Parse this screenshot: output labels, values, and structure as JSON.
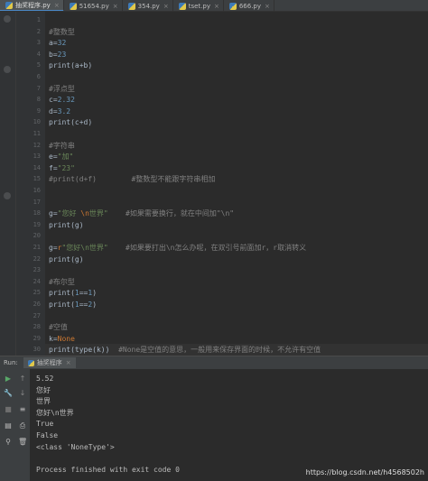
{
  "tabs": [
    {
      "label": "抽奖程序.py",
      "active": true
    },
    {
      "label": "51654.py",
      "active": false
    },
    {
      "label": "354.py",
      "active": false
    },
    {
      "label": "tset.py",
      "active": false
    },
    {
      "label": "666.py",
      "active": false
    }
  ],
  "tab_close_glyph": "×",
  "current_line": 30,
  "code_lines": [
    {
      "n": "1",
      "tokens": []
    },
    {
      "n": "2",
      "tokens": [
        {
          "t": "#整数型",
          "c": "cmt"
        }
      ]
    },
    {
      "n": "3",
      "tokens": [
        {
          "t": "a=",
          "c": "plain"
        },
        {
          "t": "32",
          "c": "num"
        }
      ]
    },
    {
      "n": "4",
      "tokens": [
        {
          "t": "b=",
          "c": "plain"
        },
        {
          "t": "23",
          "c": "num"
        }
      ]
    },
    {
      "n": "5",
      "tokens": [
        {
          "t": "print(a+b)",
          "c": "plain"
        }
      ]
    },
    {
      "n": "6",
      "tokens": []
    },
    {
      "n": "7",
      "tokens": [
        {
          "t": "#浮点型",
          "c": "cmt"
        }
      ]
    },
    {
      "n": "8",
      "tokens": [
        {
          "t": "c=",
          "c": "plain"
        },
        {
          "t": "2.32",
          "c": "num"
        }
      ]
    },
    {
      "n": "9",
      "tokens": [
        {
          "t": "d=",
          "c": "plain"
        },
        {
          "t": "3.2",
          "c": "num"
        }
      ]
    },
    {
      "n": "10",
      "tokens": [
        {
          "t": "print(c+d)",
          "c": "plain"
        }
      ]
    },
    {
      "n": "11",
      "tokens": []
    },
    {
      "n": "12",
      "tokens": [
        {
          "t": "#字符串",
          "c": "cmt"
        }
      ]
    },
    {
      "n": "13",
      "tokens": [
        {
          "t": "e=",
          "c": "plain"
        },
        {
          "t": "\"加\"",
          "c": "str"
        }
      ]
    },
    {
      "n": "14",
      "tokens": [
        {
          "t": "f=",
          "c": "plain"
        },
        {
          "t": "\"23\"",
          "c": "str"
        }
      ]
    },
    {
      "n": "15",
      "tokens": [
        {
          "t": "#print(d+f)        #整数型不能跟字符串相加",
          "c": "cmt"
        }
      ]
    },
    {
      "n": "16",
      "tokens": []
    },
    {
      "n": "17",
      "tokens": []
    },
    {
      "n": "18",
      "tokens": [
        {
          "t": "g=",
          "c": "plain"
        },
        {
          "t": "\"您好 ",
          "c": "str"
        },
        {
          "t": "\\n",
          "c": "kw"
        },
        {
          "t": "世界\"",
          "c": "str"
        },
        {
          "t": "    #如果需要换行，就在中间加\"\\n\"",
          "c": "cmt"
        }
      ]
    },
    {
      "n": "19",
      "tokens": [
        {
          "t": "print(g)",
          "c": "plain"
        }
      ]
    },
    {
      "n": "20",
      "tokens": []
    },
    {
      "n": "21",
      "tokens": [
        {
          "t": "g=",
          "c": "plain"
        },
        {
          "t": "r",
          "c": "kw"
        },
        {
          "t": "\"您好\\n世界\"",
          "c": "str"
        },
        {
          "t": "    #如果要打出\\n怎么办呢，在双引号前面加r，r取消转义",
          "c": "cmt"
        }
      ]
    },
    {
      "n": "22",
      "tokens": [
        {
          "t": "print(g)",
          "c": "plain"
        }
      ]
    },
    {
      "n": "23",
      "tokens": []
    },
    {
      "n": "24",
      "tokens": [
        {
          "t": "#布尔型",
          "c": "cmt"
        }
      ]
    },
    {
      "n": "25",
      "tokens": [
        {
          "t": "print(",
          "c": "plain"
        },
        {
          "t": "1",
          "c": "num"
        },
        {
          "t": "==",
          "c": "plain"
        },
        {
          "t": "1",
          "c": "num"
        },
        {
          "t": ")",
          "c": "plain"
        }
      ]
    },
    {
      "n": "26",
      "tokens": [
        {
          "t": "print(",
          "c": "plain"
        },
        {
          "t": "1",
          "c": "num"
        },
        {
          "t": "==",
          "c": "plain"
        },
        {
          "t": "2",
          "c": "num"
        },
        {
          "t": ")",
          "c": "plain"
        }
      ]
    },
    {
      "n": "27",
      "tokens": []
    },
    {
      "n": "28",
      "tokens": [
        {
          "t": "#空值",
          "c": "cmt"
        }
      ]
    },
    {
      "n": "29",
      "tokens": [
        {
          "t": "k=",
          "c": "plain"
        },
        {
          "t": "None",
          "c": "kw"
        }
      ]
    },
    {
      "n": "30",
      "tokens": [
        {
          "t": "print(type(k))  ",
          "c": "plain"
        },
        {
          "t": "#None是空值的意思，一般用来保存界面的时候，不允许有空值",
          "c": "cmt"
        }
      ]
    }
  ],
  "run_panel": {
    "header_label": "Run:",
    "tab_label": "抽奖程序",
    "output": [
      "5.52",
      "您好",
      "世界",
      "您好\\n世界",
      "True",
      "False",
      "<class 'NoneType'>",
      "",
      "Process finished with exit code 0"
    ]
  },
  "tool_icons": [
    {
      "name": "run-icon",
      "glyph": "▶",
      "color": "#59a869"
    },
    {
      "name": "up-arrow-icon",
      "glyph": "↑",
      "color": "#888888"
    },
    {
      "name": "wrench-icon",
      "glyph": "🔧",
      "color": "#bbbbbb"
    },
    {
      "name": "down-arrow-icon",
      "glyph": "↓",
      "color": "#888888"
    },
    {
      "name": "stop-icon",
      "glyph": "■",
      "color": "#6e6e6e"
    },
    {
      "name": "soft-wrap-icon",
      "glyph": "≡",
      "color": "#bbbbbb"
    },
    {
      "name": "layout-icon",
      "glyph": "▤",
      "color": "#bbbbbb"
    },
    {
      "name": "print-icon",
      "glyph": "⎙",
      "color": "#bbbbbb"
    },
    {
      "name": "pin-icon",
      "glyph": "⚲",
      "color": "#bbbbbb"
    },
    {
      "name": "trash-icon",
      "glyph": "🗑",
      "color": "#bbbbbb"
    }
  ],
  "watermark": "https://blog.csdn.net/h4568502h"
}
